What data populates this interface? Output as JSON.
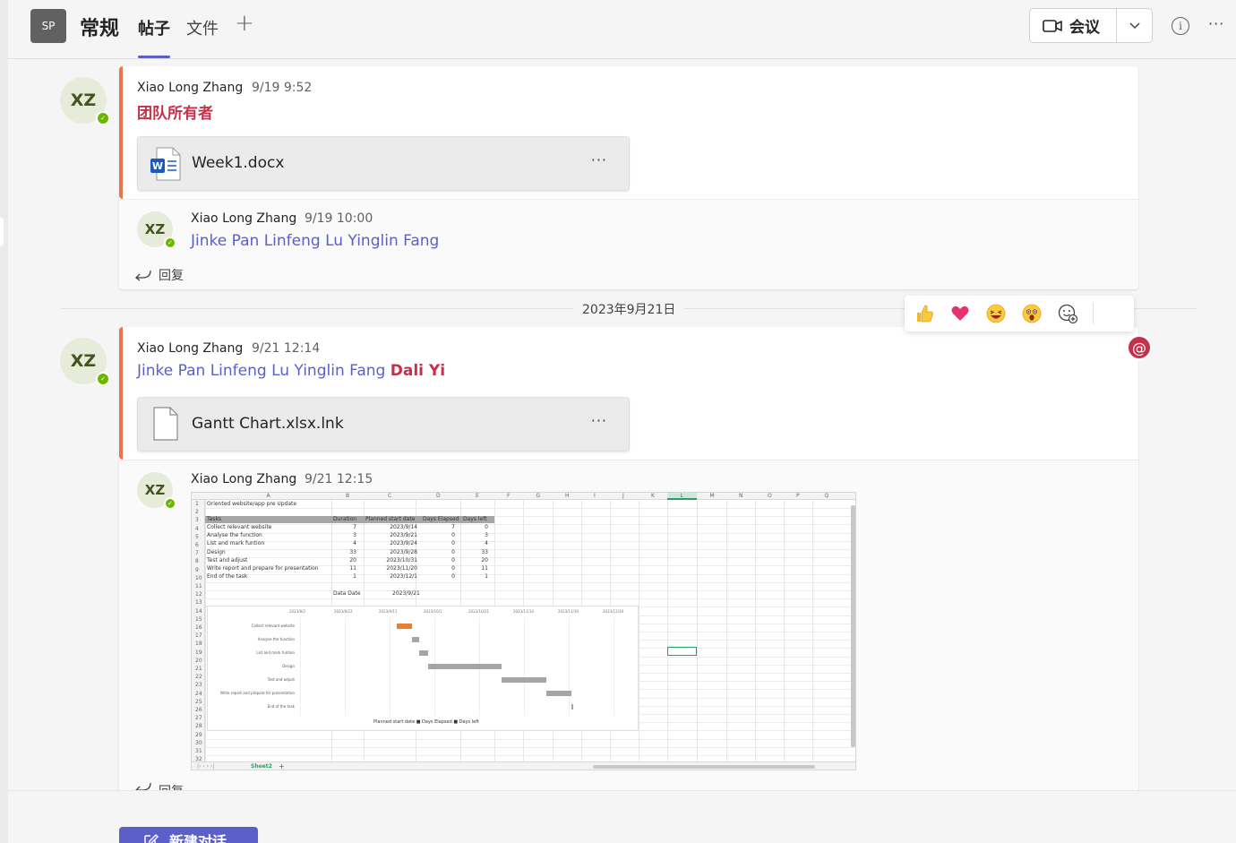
{
  "header": {
    "team_avatar": "SP",
    "channel": "常规",
    "tabs": [
      {
        "label": "帖子",
        "active": true
      },
      {
        "label": "文件",
        "active": false
      }
    ],
    "meet_label": "会议"
  },
  "posts": [
    {
      "avatar": "XZ",
      "author": "Xiao Long Zhang",
      "time": "9/19 9:52",
      "role": "团队所有者",
      "file": {
        "name": "Week1.docx",
        "type": "word"
      },
      "reply": {
        "avatar": "XZ",
        "author": "Xiao Long Zhang",
        "time": "9/19 10:00",
        "mentions": "Jinke Pan Linfeng Lu Yinglin Fang"
      },
      "reply_label": "回复"
    },
    {
      "avatar": "XZ",
      "author": "Xiao Long Zhang",
      "time": "9/21 12:14",
      "mentions": "Jinke Pan Linfeng Lu Yinglin Fang",
      "mention_highlight": "Dali Yi",
      "file": {
        "name": "Gantt Chart.xlsx.lnk",
        "type": "generic"
      },
      "reply": {
        "avatar": "XZ",
        "author": "Xiao Long Zhang",
        "time": "9/21 12:15"
      },
      "reply_label": "回复"
    }
  ],
  "date_divider": "2023年9月21日",
  "reactions": [
    "like",
    "heart",
    "laugh",
    "surprised",
    "add-reaction"
  ],
  "new_conversation_label": "新建对话",
  "spreadsheet": {
    "columns": [
      "A",
      "B",
      "C",
      "D",
      "E",
      "F",
      "G",
      "H",
      "I",
      "J",
      "K",
      "L",
      "M",
      "N",
      "O",
      "P",
      "Q"
    ],
    "title_cell": "Oriented website/app pre Update",
    "headers": [
      "Tasks",
      "Duration",
      "Planned start date",
      "Days Elapsed",
      "Days left"
    ],
    "rows": [
      [
        "Collect relevant website",
        "7",
        "2023/9/14",
        "7",
        "0"
      ],
      [
        "Analyse the function",
        "3",
        "2023/9/21",
        "0",
        "3"
      ],
      [
        "List and mark funtion",
        "4",
        "2023/9/24",
        "0",
        "4"
      ],
      [
        "Design",
        "33",
        "2023/9/28",
        "0",
        "33"
      ],
      [
        "Test and adjust",
        "20",
        "2023/10/31",
        "0",
        "20"
      ],
      [
        "Write report and prepare for presentation",
        "11",
        "2023/11/20",
        "0",
        "11"
      ],
      [
        "End of the task",
        "1",
        "2023/12/1",
        "0",
        "1"
      ]
    ],
    "data_date_label": "Data Date",
    "data_date": "2023/9/21",
    "chart_axis": [
      "2023/8/2",
      "2023/8/22",
      "2023/9/11",
      "2023/10/1",
      "2023/10/21",
      "2023/11/10",
      "2023/11/30",
      "2023/12/20"
    ],
    "chart_legend": "Planned start date ■ Days Elapsed ■ Days left",
    "sheet_tab": "Sheet2"
  },
  "colors": {
    "accent": "#e97548",
    "brand": "#5b5fc7",
    "mention_alert": "#c4314b",
    "presence": "#6bb700"
  }
}
